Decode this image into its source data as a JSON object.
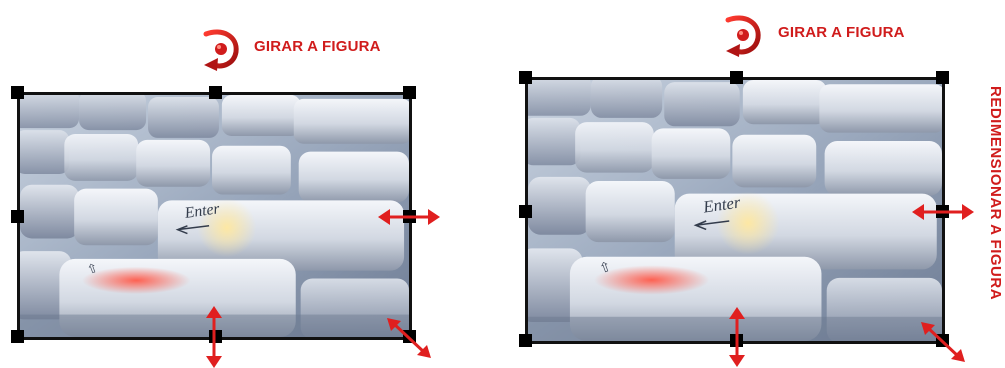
{
  "left_panel": {
    "rotate_label": "GIRAR A FIGURA",
    "photo_subject": "keyboard-photo"
  },
  "right_panel": {
    "rotate_label": "GIRAR A FIGURA",
    "resize_label": "REDIMENSIONAR A FIGURA",
    "photo_subject": "keyboard-photo"
  },
  "photo": {
    "key_text": "Enter"
  },
  "colors": {
    "accent": "#d01c1c",
    "handle": "#000000",
    "frame": "#111111"
  },
  "icons": {
    "rotate": "rotate-icon",
    "resize_horizontal": "resize-horizontal-arrow-icon",
    "resize_vertical": "resize-vertical-arrow-icon",
    "resize_diagonal": "resize-diagonal-arrow-icon"
  }
}
